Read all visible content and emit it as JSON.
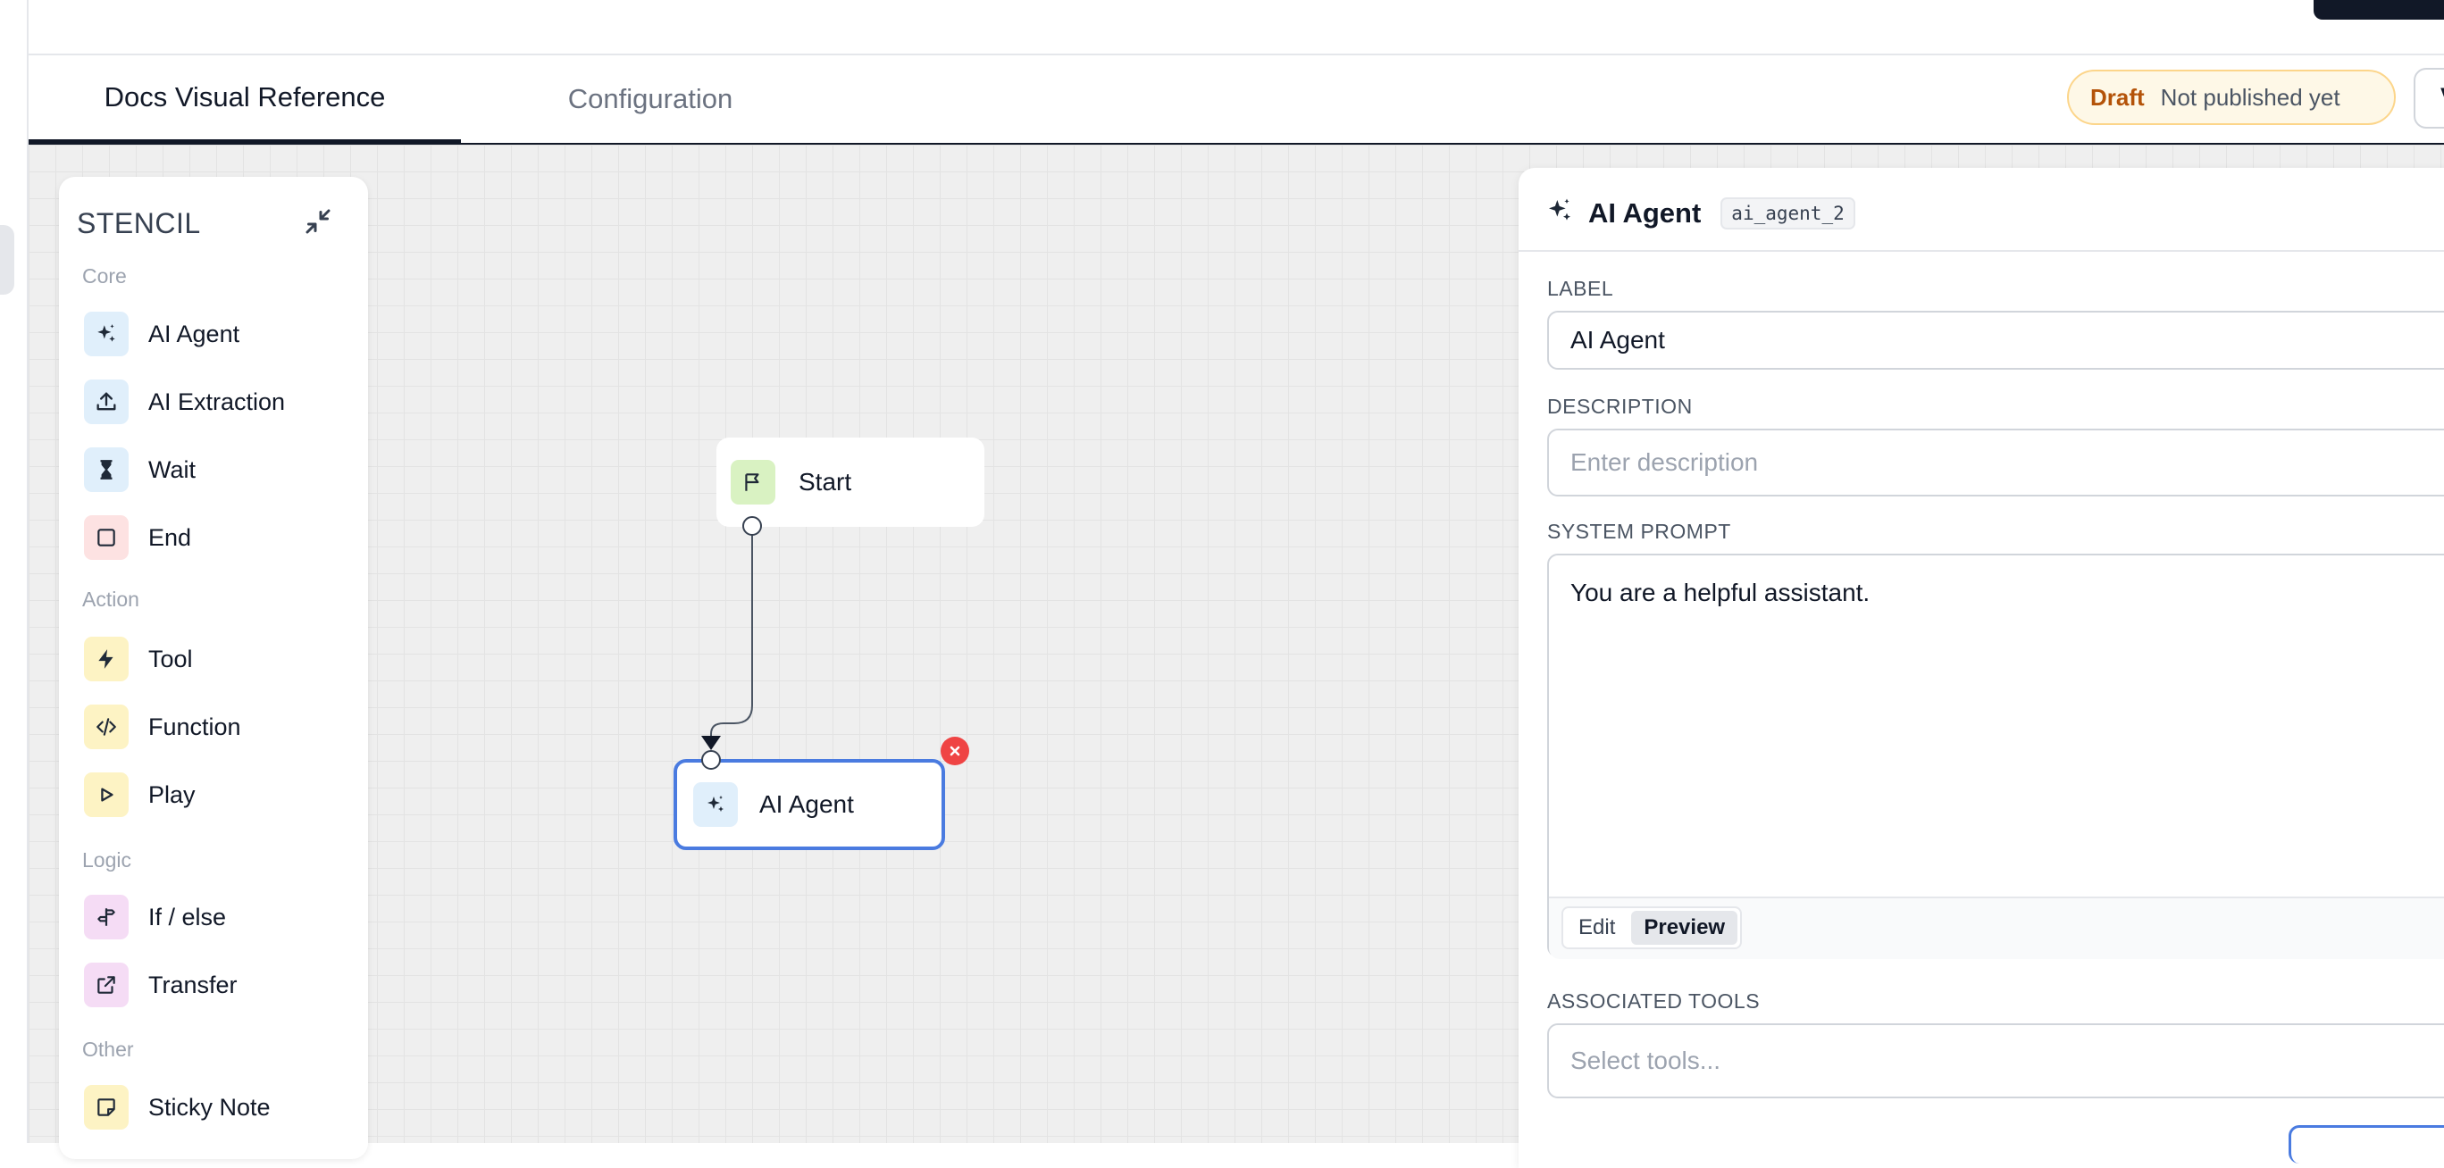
{
  "tabs": [
    {
      "label": "Docs Visual Reference",
      "active": true
    },
    {
      "label": "Configuration",
      "active": false
    }
  ],
  "status": {
    "draft": "Draft",
    "note": "Not published yet"
  },
  "version_button": "Ve",
  "stencil": {
    "title": "STENCIL",
    "sections": {
      "core": "Core",
      "action": "Action",
      "logic": "Logic",
      "other": "Other"
    },
    "items": {
      "ai_agent": "AI Agent",
      "ai_extraction": "AI Extraction",
      "wait": "Wait",
      "end": "End",
      "tool": "Tool",
      "function": "Function",
      "play": "Play",
      "if_else": "If / else",
      "transfer": "Transfer",
      "sticky_note": "Sticky Note"
    }
  },
  "nodes": {
    "start": "Start",
    "agent": "AI Agent"
  },
  "panel": {
    "title": "AI Agent",
    "node_id": "ai_agent_2",
    "label_heading": "LABEL",
    "label_value": "AI Agent",
    "description_heading": "DESCRIPTION",
    "description_placeholder": "Enter description",
    "prompt_heading": "SYSTEM PROMPT",
    "prompt_value": "You are a helpful assistant.",
    "edit_tab": "Edit",
    "preview_tab": "Preview",
    "tools_heading": "ASSOCIATED TOOLS",
    "tools_placeholder": "Select tools..."
  },
  "colors": {
    "accent": "#4a7be0",
    "draft": "#b45309",
    "danger": "#ef4444"
  }
}
